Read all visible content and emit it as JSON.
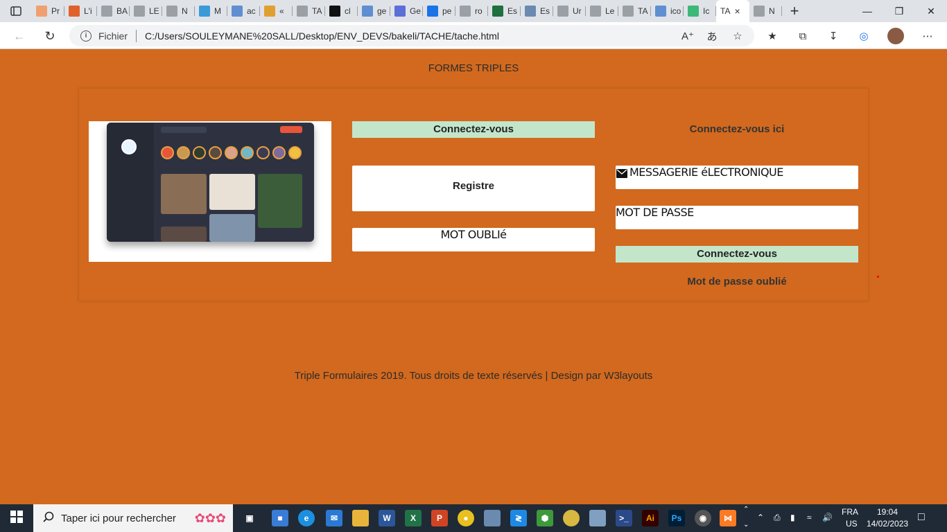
{
  "browser": {
    "tabs": [
      {
        "label": "Pr",
        "color": "#f0a070"
      },
      {
        "label": "L'i",
        "color": "#e0622a"
      },
      {
        "label": "BA",
        "color": "#9aa0a6"
      },
      {
        "label": "LE",
        "color": "#9aa0a6"
      },
      {
        "label": "N",
        "color": "#9aa0a6"
      },
      {
        "label": "M",
        "color": "#3a9ad9"
      },
      {
        "label": "ac",
        "color": "#5f8fd0"
      },
      {
        "label": "«",
        "color": "#e0a030"
      },
      {
        "label": "TA",
        "color": "#9aa0a6"
      },
      {
        "label": "cl",
        "color": "#111111"
      },
      {
        "label": "ge",
        "color": "#5f8fd0"
      },
      {
        "label": "Ge",
        "color": "#5a6fd8"
      },
      {
        "label": "pe",
        "color": "#1a73e8"
      },
      {
        "label": "ro",
        "color": "#9aa0a6"
      },
      {
        "label": "Es",
        "color": "#1f6f3f"
      },
      {
        "label": "Es",
        "color": "#6a8ab0"
      },
      {
        "label": "Ur",
        "color": "#9aa0a6"
      },
      {
        "label": "Le",
        "color": "#9aa0a6"
      },
      {
        "label": "TA",
        "color": "#9aa0a6"
      },
      {
        "label": "ico",
        "color": "#5f8fd0"
      },
      {
        "label": "Ic",
        "color": "#3cb878"
      },
      {
        "label": "TA",
        "color": "#9aa0a6",
        "active": true
      },
      {
        "label": "N",
        "color": "#9aa0a6"
      }
    ],
    "url_scheme_label": "Fichier",
    "url": "C:/Users/SOULEYMANE%20SALL/Desktop/ENV_DEVS/bakeli/TACHE/tache.html"
  },
  "page": {
    "title": "FORMES TRIPLES",
    "middle": {
      "connect_label": "Connectez-vous",
      "register_label": "Registre",
      "forgot_label": "MOT OUBLIé"
    },
    "right": {
      "heading": "Connectez-vous ici",
      "email_label": "MESSAGERIE éLECTRONIQUE",
      "password_label": "MOT DE PASSE",
      "connect_label": "Connectez-vous",
      "forgot_link": "Mot de passe oublié"
    },
    "footer": "Triple Formulaires 2019. Tous droits de texte réservés | Design par W3layouts"
  },
  "taskbar": {
    "search_placeholder": "Taper ici pour rechercher",
    "lang_top": "FRA",
    "lang_bottom": "US",
    "time": "19:04",
    "date": "14/02/2023"
  },
  "colors": {
    "page_bg": "#d2691e",
    "green_button": "#c3e6cb"
  }
}
